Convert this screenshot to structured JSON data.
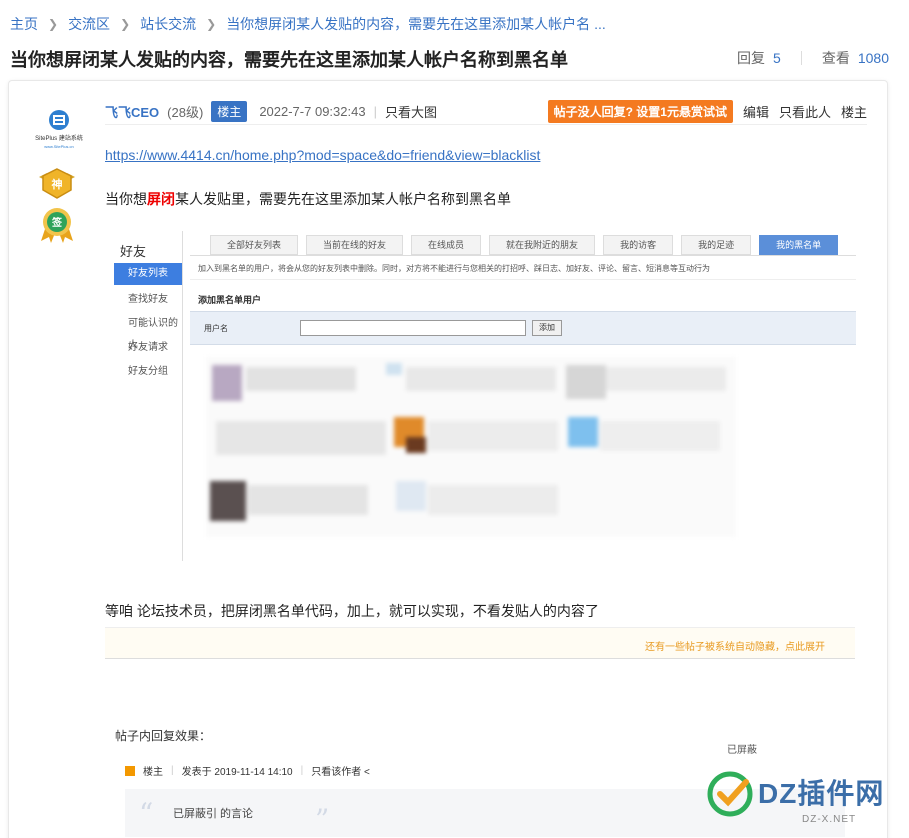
{
  "breadcrumb": {
    "items": [
      "主页",
      "交流区",
      "站长交流",
      "当你想屏闭某人发贴的内容，需要先在这里添加某人帐户名 ..."
    ]
  },
  "thread": {
    "title": "当你想屏闭某人发贴的内容，需要先在这里添加某人帐户名称到黑名单",
    "reply_label": "回复",
    "reply_count": "5",
    "view_label": "查看",
    "view_count": "1080"
  },
  "author": {
    "logo_text": "SitePlus 建站系统",
    "logo_url_text": "www.SitePlus.cn",
    "badge1_label": "神",
    "badge2_label": "签"
  },
  "post": {
    "author_name": "飞飞CEO",
    "author_level": "(28级)",
    "owner_tag": "楼主",
    "time": "2022-7-7 09:32:43",
    "view_big_image": "只看大图",
    "reward_button": "帖子没人回复? 设置1元悬赏试试",
    "edit": "编辑",
    "only_author": "只看此人",
    "floor": "楼主",
    "link": "https://www.4414.cn/home.php?mod=space&do=friend&view=blacklist",
    "line1_prefix": "当你想",
    "line1_highlight": "屏闭",
    "line1_suffix": "某人发贴里，需要先在这里添加某人帐户名称到黑名单",
    "line2": "等咱 论坛技术员，把屏闭黑名单代码，加上，就可以实现，不看发贴人的内容了"
  },
  "screenshot1": {
    "side_title": "好友",
    "side_items": [
      "好友列表",
      "查找好友",
      "可能认识的人",
      "好友请求",
      "好友分组"
    ],
    "tabs": [
      "全部好友列表",
      "当前在线的好友",
      "在线成员",
      "就在我附近的朋友",
      "我的访客",
      "我的足迹",
      "我的黑名单"
    ],
    "hint": "加入到黑名单的用户，将会从您的好友列表中删除。同时，对方将不能进行与您相关的打招呼、踩日志、加好友、评论、留言、短消息等互动行为",
    "add_title": "添加黑名单用户",
    "username_label": "用户名",
    "add_button": "添加"
  },
  "screenshot2": {
    "tip": "还有一些帖子被系统自动隐藏，点此展开",
    "reply_effect_label": "帖子内回复效果：",
    "shielded_tag": "已屏蔽",
    "reply_floor": "楼主",
    "reply_time": "发表于 2019-11-14 14:10",
    "reply_only_author": "只看该作者 <",
    "quote_text": "已屏蔽引       的言论"
  },
  "watermark": {
    "text": "DZ插件网",
    "url": "DZ-X.NET"
  },
  "colors": {
    "link": "#3873c4",
    "reward": "#f47a20",
    "highlight": "#e00000"
  }
}
